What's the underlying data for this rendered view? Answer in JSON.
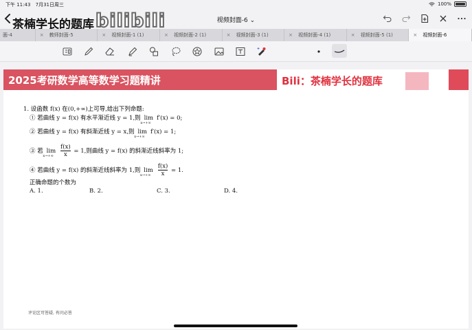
{
  "status_bar": {
    "time": "下午 11:43",
    "date": "7月31日周三",
    "battery": "100%"
  },
  "titlebar": {
    "watermark": "茶楠学长的题库",
    "logo_text": "bilibili",
    "doc_title": "视频封面-6 ⌄"
  },
  "tabs": [
    {
      "label": "面-4",
      "active": false
    },
    {
      "label": "教师封面-5",
      "active": false
    },
    {
      "label": "视频封面-1 (1)",
      "active": false
    },
    {
      "label": "视频封面-2 (1)",
      "active": false
    },
    {
      "label": "视频封面-3 (1)",
      "active": false
    },
    {
      "label": "视频封面-4 (1)",
      "active": false
    },
    {
      "label": "视频封面-5 (1)",
      "active": false
    },
    {
      "label": "视频封面-6",
      "active": true
    }
  ],
  "tab_close_glyph": "×",
  "banner": {
    "title": "2025考研数学高等数学习题精讲",
    "right_text": "Bili：茶楠学长的题库",
    "color_left": "#d95360",
    "color_pink": "#f5b7bf",
    "color_red": "#e04b5a"
  },
  "question": {
    "stem": "1. 设函数 f(x) 在(0,+∞)上可导,给出下列命题:",
    "item1_a": "① 若曲线 y = f(x) 有水平渐近线 y = 1,则",
    "item1_b": "f′(x) = 0;",
    "item2_a": "② 若曲线 y = f(x) 有斜渐近线 y = x,则",
    "item2_b": "f′(x) = 1;",
    "item3_a": "③ 若",
    "item3_b": "= 1,则曲线 y = f(x) 的斜渐近线斜率为 1;",
    "item4_a": "④ 若曲线 y = f(x) 的斜渐近线斜率为 1,则",
    "item4_b": "= 1.",
    "lim": "lim",
    "lim_sub": "x→+∞",
    "frac_num": "f(x)",
    "frac_den": "x",
    "prompt": "正确命题的个数为",
    "options": [
      "A. 1.",
      "B. 2.",
      "C. 3.",
      "D. 4."
    ]
  },
  "footnote": "评论区可答疑, 有问必答"
}
